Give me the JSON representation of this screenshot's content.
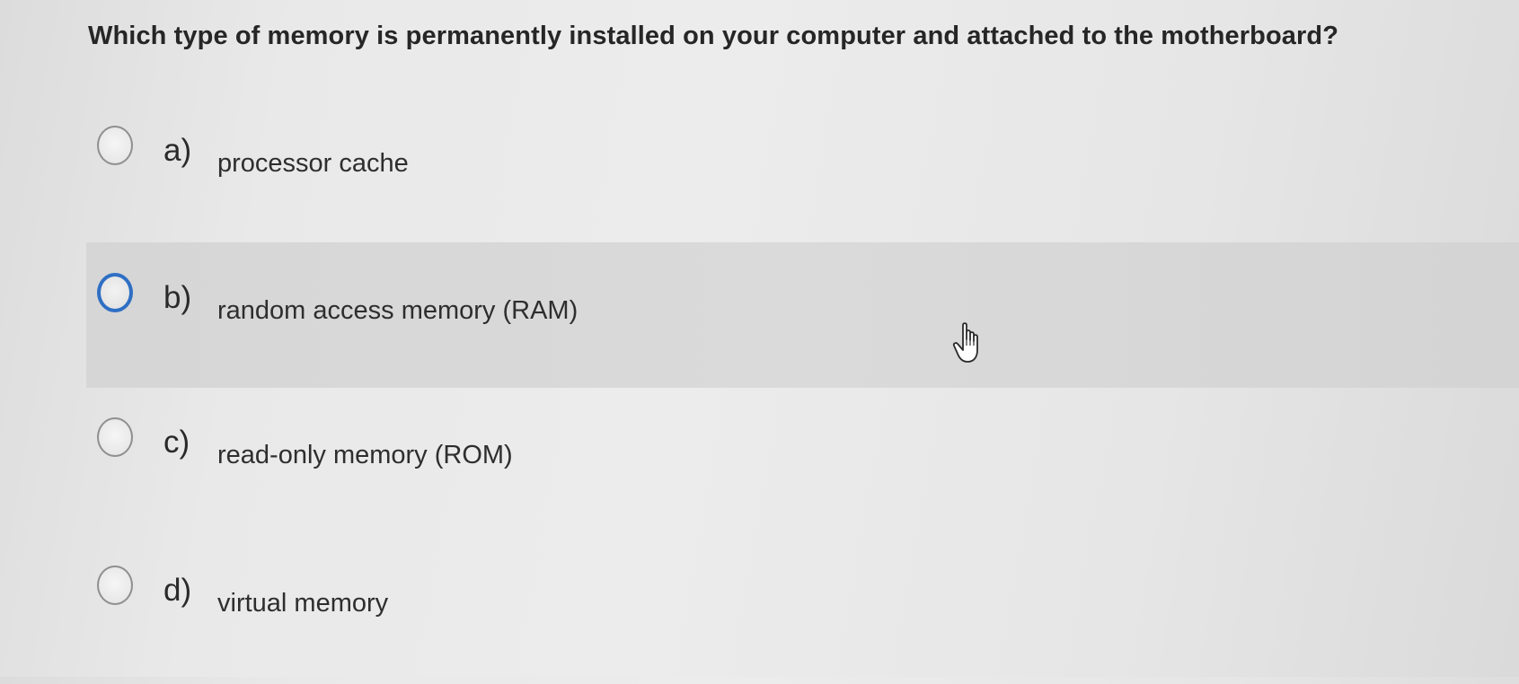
{
  "question": {
    "text": "Which type of memory is permanently installed on your computer and attached to the motherboard?"
  },
  "options": [
    {
      "letter": "a)",
      "text": "processor cache",
      "state": "default"
    },
    {
      "letter": "b)",
      "text": "random access memory (RAM)",
      "state": "hovered"
    },
    {
      "letter": "c)",
      "text": "read-only memory (ROM)",
      "state": "default"
    },
    {
      "letter": "d)",
      "text": "virtual memory",
      "state": "default"
    }
  ],
  "cursor": {
    "icon": "hand-pointer-icon"
  },
  "colors": {
    "focus_ring": "#2f6fc4",
    "hover_background": "#d8d8d8"
  }
}
